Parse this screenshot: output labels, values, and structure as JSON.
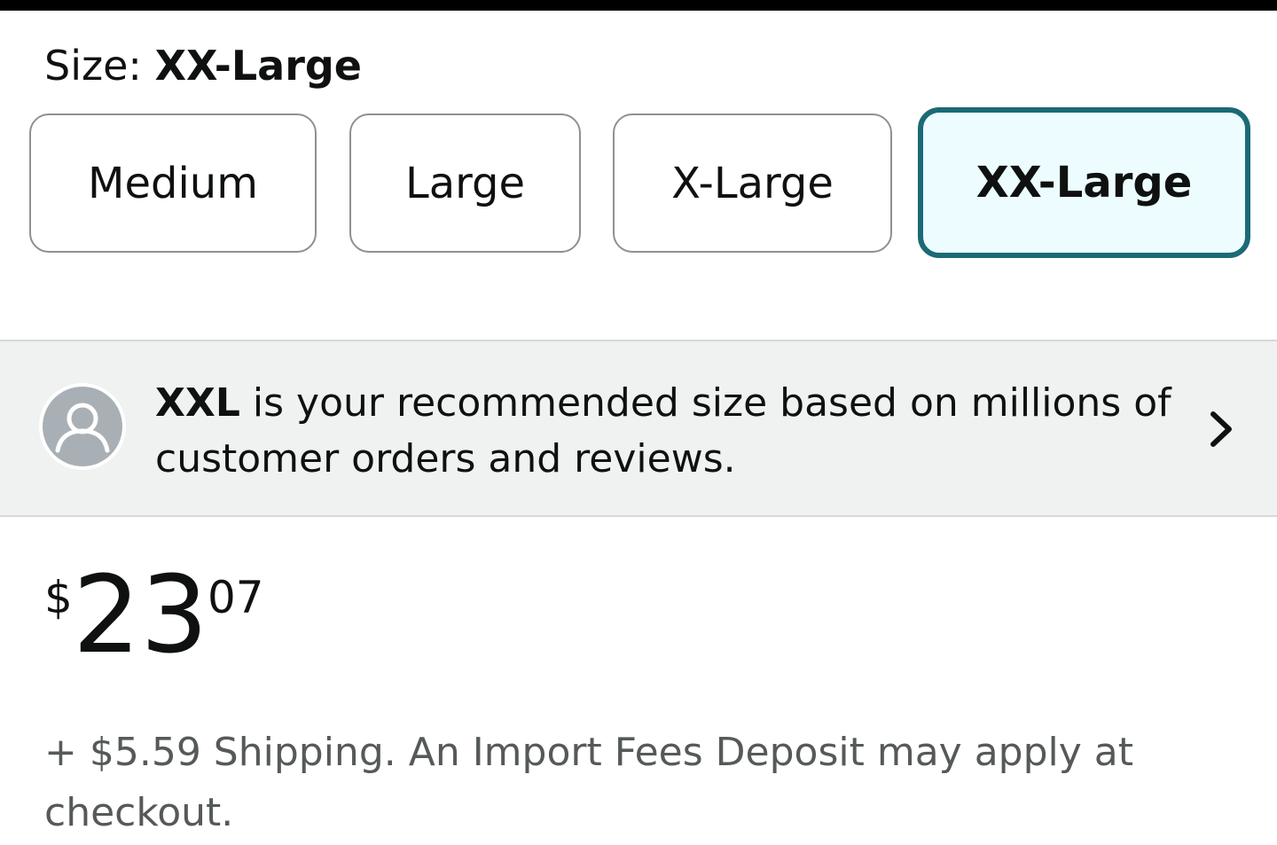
{
  "size_selector": {
    "label": "Size:",
    "selected_value": "XX-Large",
    "options": [
      {
        "label": "Medium",
        "selected": false
      },
      {
        "label": "Large",
        "selected": false
      },
      {
        "label": "X-Large",
        "selected": false
      },
      {
        "label": "XX-Large",
        "selected": true
      }
    ]
  },
  "recommendation": {
    "size": "XXL",
    "text": "is your recommended size based on millions of customer orders and reviews.",
    "icon": "user-avatar-icon",
    "arrow_icon": "chevron-right-icon"
  },
  "price": {
    "symbol": "$",
    "whole": "23",
    "fraction": "07"
  },
  "shipping": {
    "text": "+ $5.59 Shipping. An Import Fees Deposit may apply at checkout."
  },
  "colors": {
    "selected_border": "#1b6a76",
    "selected_background": "#edfdff",
    "panel_background": "#f0f2f2",
    "secondary_text": "#565959"
  }
}
